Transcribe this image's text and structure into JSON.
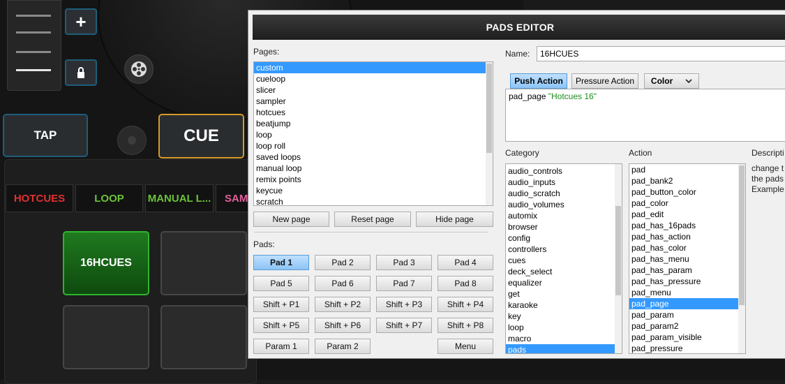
{
  "background": {
    "tap_label": "TAP",
    "cue_label": "CUE",
    "plus_label": "+",
    "page_tabs": [
      {
        "label": "HOTCUES",
        "color": "#e23030"
      },
      {
        "label": "LOOP",
        "color": "#6cc23a"
      },
      {
        "label": "MANUAL L...",
        "color": "#6cc23a"
      },
      {
        "label": "SAM",
        "color": "#e0609a"
      }
    ],
    "active_pad_label": "16HCUES"
  },
  "dialog": {
    "title": "PADS EDITOR",
    "pages_label": "Pages:",
    "pages": [
      "custom",
      "cueloop",
      "slicer",
      "sampler",
      "hotcues",
      "beatjump",
      "loop",
      "loop roll",
      "saved loops",
      "manual loop",
      "remix points",
      "keycue",
      "scratch"
    ],
    "selected_page": "custom",
    "page_buttons": {
      "new": "New page",
      "reset": "Reset page",
      "hide": "Hide page"
    },
    "pads_label": "Pads:",
    "pads": [
      "Pad 1",
      "Pad 2",
      "Pad 3",
      "Pad 4",
      "Pad 5",
      "Pad 6",
      "Pad 7",
      "Pad 8",
      "Shift + P1",
      "Shift + P2",
      "Shift + P3",
      "Shift + P4",
      "Shift + P5",
      "Shift + P6",
      "Shift + P7",
      "Shift + P8"
    ],
    "selected_pad": "Pad 1",
    "param_buttons": [
      "Param 1",
      "Param 2"
    ],
    "menu_button": "Menu",
    "name_label": "Name:",
    "name_value": "16HCUES",
    "tabs": {
      "push": "Push Action",
      "pressure": "Pressure Action",
      "color": "Color"
    },
    "script_keyword": "pad_page",
    "script_string": "\"Hotcues 16\"",
    "category_label": "Category",
    "categories": [
      "audio_controls",
      "audio_inputs",
      "audio_scratch",
      "audio_volumes",
      "automix",
      "browser",
      "config",
      "controllers",
      "cues",
      "deck_select",
      "equalizer",
      "get",
      "karaoke",
      "key",
      "loop",
      "macro",
      "pads"
    ],
    "selected_category": "pads",
    "action_label": "Action",
    "actions": [
      "pad",
      "pad_bank2",
      "pad_button_color",
      "pad_color",
      "pad_edit",
      "pad_has_16pads",
      "pad_has_action",
      "pad_has_color",
      "pad_has_menu",
      "pad_has_param",
      "pad_has_pressure",
      "pad_menu",
      "pad_page",
      "pad_param",
      "pad_param2",
      "pad_param_visible",
      "pad_pressure"
    ],
    "selected_action": "pad_page",
    "description_label": "Descripti",
    "description_lines": [
      "change t",
      "the pads",
      "Example"
    ]
  }
}
